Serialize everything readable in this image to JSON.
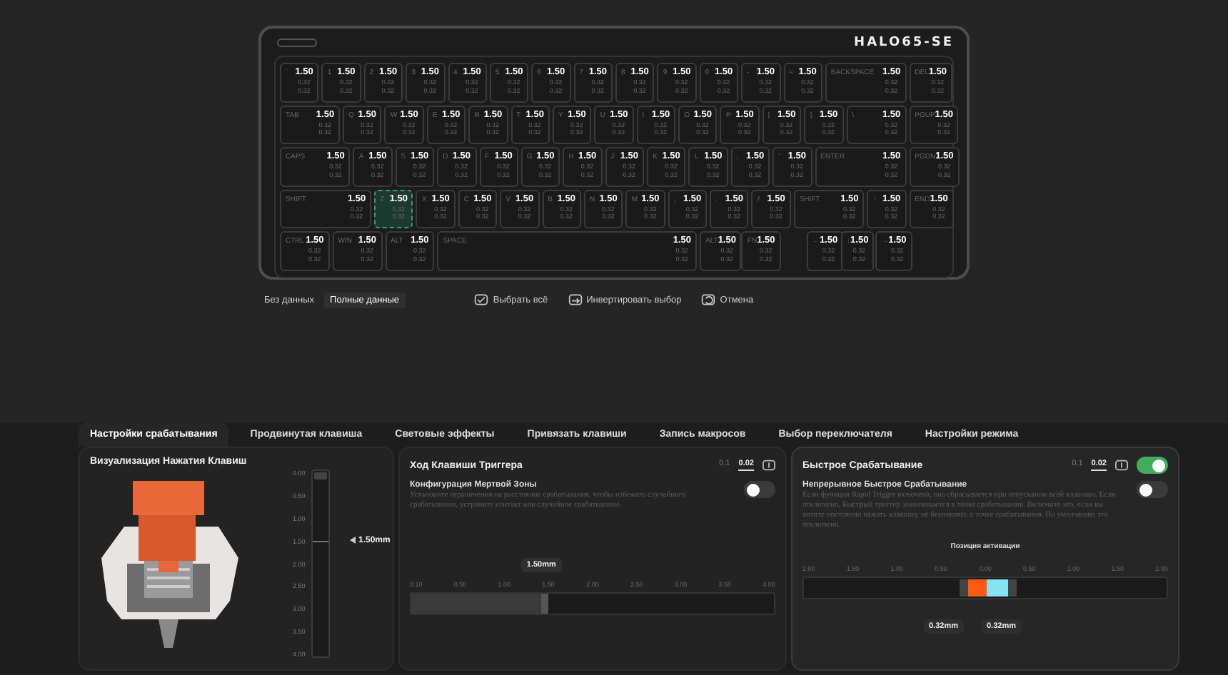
{
  "keyboard": {
    "logo": "HALO65-SE",
    "rows": [
      [
        {
          "label": "`",
          "actuation": "1.50",
          "lower": [
            "0.32",
            "0.32"
          ],
          "selected": false
        },
        {
          "label": "1",
          "actuation": "1.50",
          "lower": [
            "0.32",
            "0.32"
          ],
          "selected": false
        },
        {
          "label": "2",
          "actuation": "1.50",
          "lower": [
            "0.32",
            "0.32"
          ],
          "selected": false
        },
        {
          "label": "3",
          "actuation": "1.50",
          "lower": [
            "0.32",
            "0.32"
          ],
          "selected": false
        },
        {
          "label": "4",
          "actuation": "1.50",
          "lower": [
            "0.32",
            "0.32"
          ],
          "selected": false
        },
        {
          "label": "5",
          "actuation": "1.50",
          "lower": [
            "0.32",
            "0.32"
          ],
          "selected": false
        },
        {
          "label": "6",
          "actuation": "1.50",
          "lower": [
            "0.32",
            "0.32"
          ],
          "selected": false
        },
        {
          "label": "7",
          "actuation": "1.50",
          "lower": [
            "0.32",
            "0.32"
          ],
          "selected": false
        },
        {
          "label": "8",
          "actuation": "1.50",
          "lower": [
            "0.32",
            "0.32"
          ],
          "selected": false
        },
        {
          "label": "9",
          "actuation": "1.50",
          "lower": [
            "0.32",
            "0.32"
          ],
          "selected": false
        },
        {
          "label": "0",
          "actuation": "1.50",
          "lower": [
            "0.32",
            "0.32"
          ],
          "selected": false
        },
        {
          "label": "-",
          "actuation": "1.50",
          "lower": [
            "0.32",
            "0.32"
          ],
          "selected": false
        },
        {
          "label": "=",
          "actuation": "1.50",
          "lower": [
            "0.32",
            "0.32"
          ],
          "selected": false
        },
        {
          "label": "BACKSPACE",
          "actuation": "1.50",
          "lower": [
            "0.32",
            "0.32"
          ],
          "selected": false
        },
        {
          "label": "DEL",
          "actuation": "1.50",
          "lower": [
            "0.32",
            "0.32"
          ],
          "selected": false
        }
      ],
      [
        {
          "label": "TAB",
          "actuation": "1.50",
          "lower": [
            "0.32",
            "0.32"
          ],
          "selected": false
        },
        {
          "label": "Q",
          "actuation": "1.50",
          "lower": [
            "0.32",
            "0.32"
          ],
          "selected": false
        },
        {
          "label": "W",
          "actuation": "1.50",
          "lower": [
            "0.32",
            "0.32"
          ],
          "selected": false
        },
        {
          "label": "E",
          "actuation": "1.50",
          "lower": [
            "0.32",
            "0.32"
          ],
          "selected": false
        },
        {
          "label": "R",
          "actuation": "1.50",
          "lower": [
            "0.32",
            "0.32"
          ],
          "selected": false
        },
        {
          "label": "T",
          "actuation": "1.50",
          "lower": [
            "0.32",
            "0.32"
          ],
          "selected": false
        },
        {
          "label": "Y",
          "actuation": "1.50",
          "lower": [
            "0.32",
            "0.32"
          ],
          "selected": false
        },
        {
          "label": "U",
          "actuation": "1.50",
          "lower": [
            "0.32",
            "0.32"
          ],
          "selected": false
        },
        {
          "label": "I",
          "actuation": "1.50",
          "lower": [
            "0.32",
            "0.32"
          ],
          "selected": false
        },
        {
          "label": "O",
          "actuation": "1.50",
          "lower": [
            "0.32",
            "0.32"
          ],
          "selected": false
        },
        {
          "label": "P",
          "actuation": "1.50",
          "lower": [
            "0.32",
            "0.32"
          ],
          "selected": false
        },
        {
          "label": "[",
          "actuation": "1.50",
          "lower": [
            "0.32",
            "0.32"
          ],
          "selected": false
        },
        {
          "label": "]",
          "actuation": "1.50",
          "lower": [
            "0.32",
            "0.32"
          ],
          "selected": false
        },
        {
          "label": "\\",
          "actuation": "1.50",
          "lower": [
            "0.32",
            "0.32"
          ],
          "selected": false
        },
        {
          "label": "PGUP",
          "actuation": "1.50",
          "lower": [
            "0.32",
            "0.32"
          ],
          "selected": false
        }
      ],
      [
        {
          "label": "CAPS",
          "actuation": "1.50",
          "lower": [
            "0.32",
            "0.32"
          ],
          "selected": false
        },
        {
          "label": "A",
          "actuation": "1.50",
          "lower": [
            "0.32",
            "0.32"
          ],
          "selected": false
        },
        {
          "label": "S",
          "actuation": "1.50",
          "lower": [
            "0.32",
            "0.32"
          ],
          "selected": false
        },
        {
          "label": "D",
          "actuation": "1.50",
          "lower": [
            "0.32",
            "0.32"
          ],
          "selected": false
        },
        {
          "label": "F",
          "actuation": "1.50",
          "lower": [
            "0.32",
            "0.32"
          ],
          "selected": false
        },
        {
          "label": "G",
          "actuation": "1.50",
          "lower": [
            "0.32",
            "0.32"
          ],
          "selected": false
        },
        {
          "label": "H",
          "actuation": "1.50",
          "lower": [
            "0.32",
            "0.32"
          ],
          "selected": false
        },
        {
          "label": "J",
          "actuation": "1.50",
          "lower": [
            "0.32",
            "0.32"
          ],
          "selected": false
        },
        {
          "label": "K",
          "actuation": "1.50",
          "lower": [
            "0.32",
            "0.32"
          ],
          "selected": false
        },
        {
          "label": "L",
          "actuation": "1.50",
          "lower": [
            "0.32",
            "0.32"
          ],
          "selected": false
        },
        {
          "label": ";",
          "actuation": "1.50",
          "lower": [
            "0.32",
            "0.32"
          ],
          "selected": false
        },
        {
          "label": "'",
          "actuation": "1.50",
          "lower": [
            "0.32",
            "0.32"
          ],
          "selected": false
        },
        {
          "label": "ENTER",
          "actuation": "1.50",
          "lower": [
            "0.32",
            "0.32"
          ],
          "selected": false
        },
        {
          "label": "PGDN",
          "actuation": "1.50",
          "lower": [
            "0.32",
            "0.32"
          ],
          "selected": false
        }
      ],
      [
        {
          "label": "SHIFT",
          "actuation": "1.50",
          "lower": [
            "0.32",
            "0.32"
          ],
          "selected": false
        },
        {
          "label": "Z",
          "actuation": "1.50",
          "lower": [
            "0.32",
            "0.32"
          ],
          "selected": true
        },
        {
          "label": "X",
          "actuation": "1.50",
          "lower": [
            "0.32",
            "0.32"
          ],
          "selected": false
        },
        {
          "label": "C",
          "actuation": "1.50",
          "lower": [
            "0.32",
            "0.32"
          ],
          "selected": false
        },
        {
          "label": "V",
          "actuation": "1.50",
          "lower": [
            "0.32",
            "0.32"
          ],
          "selected": false
        },
        {
          "label": "B",
          "actuation": "1.50",
          "lower": [
            "0.32",
            "0.32"
          ],
          "selected": false
        },
        {
          "label": "N",
          "actuation": "1.50",
          "lower": [
            "0.32",
            "0.32"
          ],
          "selected": false
        },
        {
          "label": "M",
          "actuation": "1.50",
          "lower": [
            "0.32",
            "0.32"
          ],
          "selected": false
        },
        {
          "label": ",",
          "actuation": "1.50",
          "lower": [
            "0.32",
            "0.32"
          ],
          "selected": false
        },
        {
          "label": ".",
          "actuation": "1.50",
          "lower": [
            "0.32",
            "0.32"
          ],
          "selected": false
        },
        {
          "label": "/",
          "actuation": "1.50",
          "lower": [
            "0.32",
            "0.32"
          ],
          "selected": false
        },
        {
          "label": "SHIFT",
          "actuation": "1.50",
          "lower": [
            "0.32",
            "0.32"
          ],
          "selected": false
        },
        {
          "label": "↑",
          "actuation": "1.50",
          "lower": [
            "0.32",
            "0.32"
          ],
          "selected": false
        },
        {
          "label": "END",
          "actuation": "1.50",
          "lower": [
            "0.32",
            "0.32"
          ],
          "selected": false
        }
      ],
      [
        {
          "label": "CTRL",
          "actuation": "1.50",
          "lower": [
            "0.32",
            "0.32"
          ],
          "selected": false
        },
        {
          "label": "WIN",
          "actuation": "1.50",
          "lower": [
            "0.32",
            "0.32"
          ],
          "selected": false
        },
        {
          "label": "ALT",
          "actuation": "1.50",
          "lower": [
            "0.32",
            "0.32"
          ],
          "selected": false
        },
        {
          "label": "SPACE",
          "actuation": "1.50",
          "lower": [
            "0.32",
            "0.32"
          ],
          "selected": false
        },
        {
          "label": "ALT",
          "actuation": "1.50",
          "lower": [
            "0.32",
            "0.32"
          ],
          "selected": false
        },
        {
          "label": "FN",
          "actuation": "1.50",
          "lower": [
            "0.32",
            "0.32"
          ],
          "selected": false
        },
        {
          "label": "←",
          "actuation": "1.50",
          "lower": [
            "0.32",
            "0.32"
          ],
          "selected": false
        },
        {
          "label": "↓",
          "actuation": "1.50",
          "lower": [
            "0.32",
            "0.32"
          ],
          "selected": false
        },
        {
          "label": "→",
          "actuation": "1.50",
          "lower": [
            "0.32",
            "0.32"
          ],
          "selected": false
        }
      ]
    ]
  },
  "view_modes": [
    {
      "label": "Без данных",
      "selected": false
    },
    {
      "label": "Полные данные",
      "selected": true
    }
  ],
  "actions": [
    {
      "label": "Выбрать всё",
      "kind": "select"
    },
    {
      "label": "Инвертировать выбор",
      "kind": "invert"
    },
    {
      "label": "Отмена",
      "kind": "cancel"
    }
  ],
  "tabs": [
    {
      "label": "Настройки срабатывания",
      "selected": true
    },
    {
      "label": "Продвинутая клавиша",
      "selected": false
    },
    {
      "label": "Световые эффекты",
      "selected": false
    },
    {
      "label": "Привязать клавиши",
      "selected": false
    },
    {
      "label": "Запись макросов",
      "selected": false
    },
    {
      "label": "Выбор переключателя",
      "selected": false
    },
    {
      "label": "Настройки режима",
      "selected": false
    }
  ],
  "panels": [
    {
      "kind": "visualization",
      "title": "Визуализация Нажатия Клавиш",
      "scale": [
        "0.00",
        "0.50",
        "1.00",
        "1.50",
        "2.00",
        "2.50",
        "3.00",
        "3.50",
        "4.00"
      ],
      "reading": "1.50mm",
      "level": 0.375
    },
    {
      "kind": "trigger",
      "title": "Ход Клавиши Триггера",
      "precision": [
        {
          "label": "0.1",
          "selected": false
        },
        {
          "label": "0.02",
          "selected": true
        }
      ],
      "dead_zone": {
        "title": "Конфигурация Мертвой Зоны",
        "description": "Установите ограничения на расстояние срабатывания, чтобы избежать случайного срабатывания, устраните контакт или случайное срабатывание.",
        "on": false
      },
      "slider": {
        "value": "1.50mm",
        "ticks": [
          "0.10",
          "0.50",
          "1.00",
          "1.50",
          "2.00",
          "2.50",
          "3.00",
          "3.50",
          "4.00"
        ],
        "level": 0.36
      }
    },
    {
      "kind": "rapid",
      "title": "Быстрое Срабатывание",
      "precision": [
        {
          "label": "0.1",
          "selected": false
        },
        {
          "label": "0.02",
          "selected": true
        }
      ],
      "on": true,
      "continuous": {
        "title": "Непрерывное Быстрое Срабатывание",
        "description": "Если функция Rapid Trigger включена, она сбрасывается при отпускании всей клавиши. Если отключено, Быстрый триггер заканчивается в точке срабатывания. Включите это, если вы хотите постоянно нажать клавишу, не беспокоясь о точке срабатывания. По умолчанию это отключено.",
        "on": false
      },
      "slider": {
        "label": "Позиция активации",
        "ticks": [
          "2.00",
          "1.50",
          "1.00",
          "0.50",
          "0.00",
          "0.50",
          "1.00",
          "1.50",
          "2.00"
        ],
        "press": "0.32mm",
        "release": "0.32mm"
      }
    }
  ]
}
